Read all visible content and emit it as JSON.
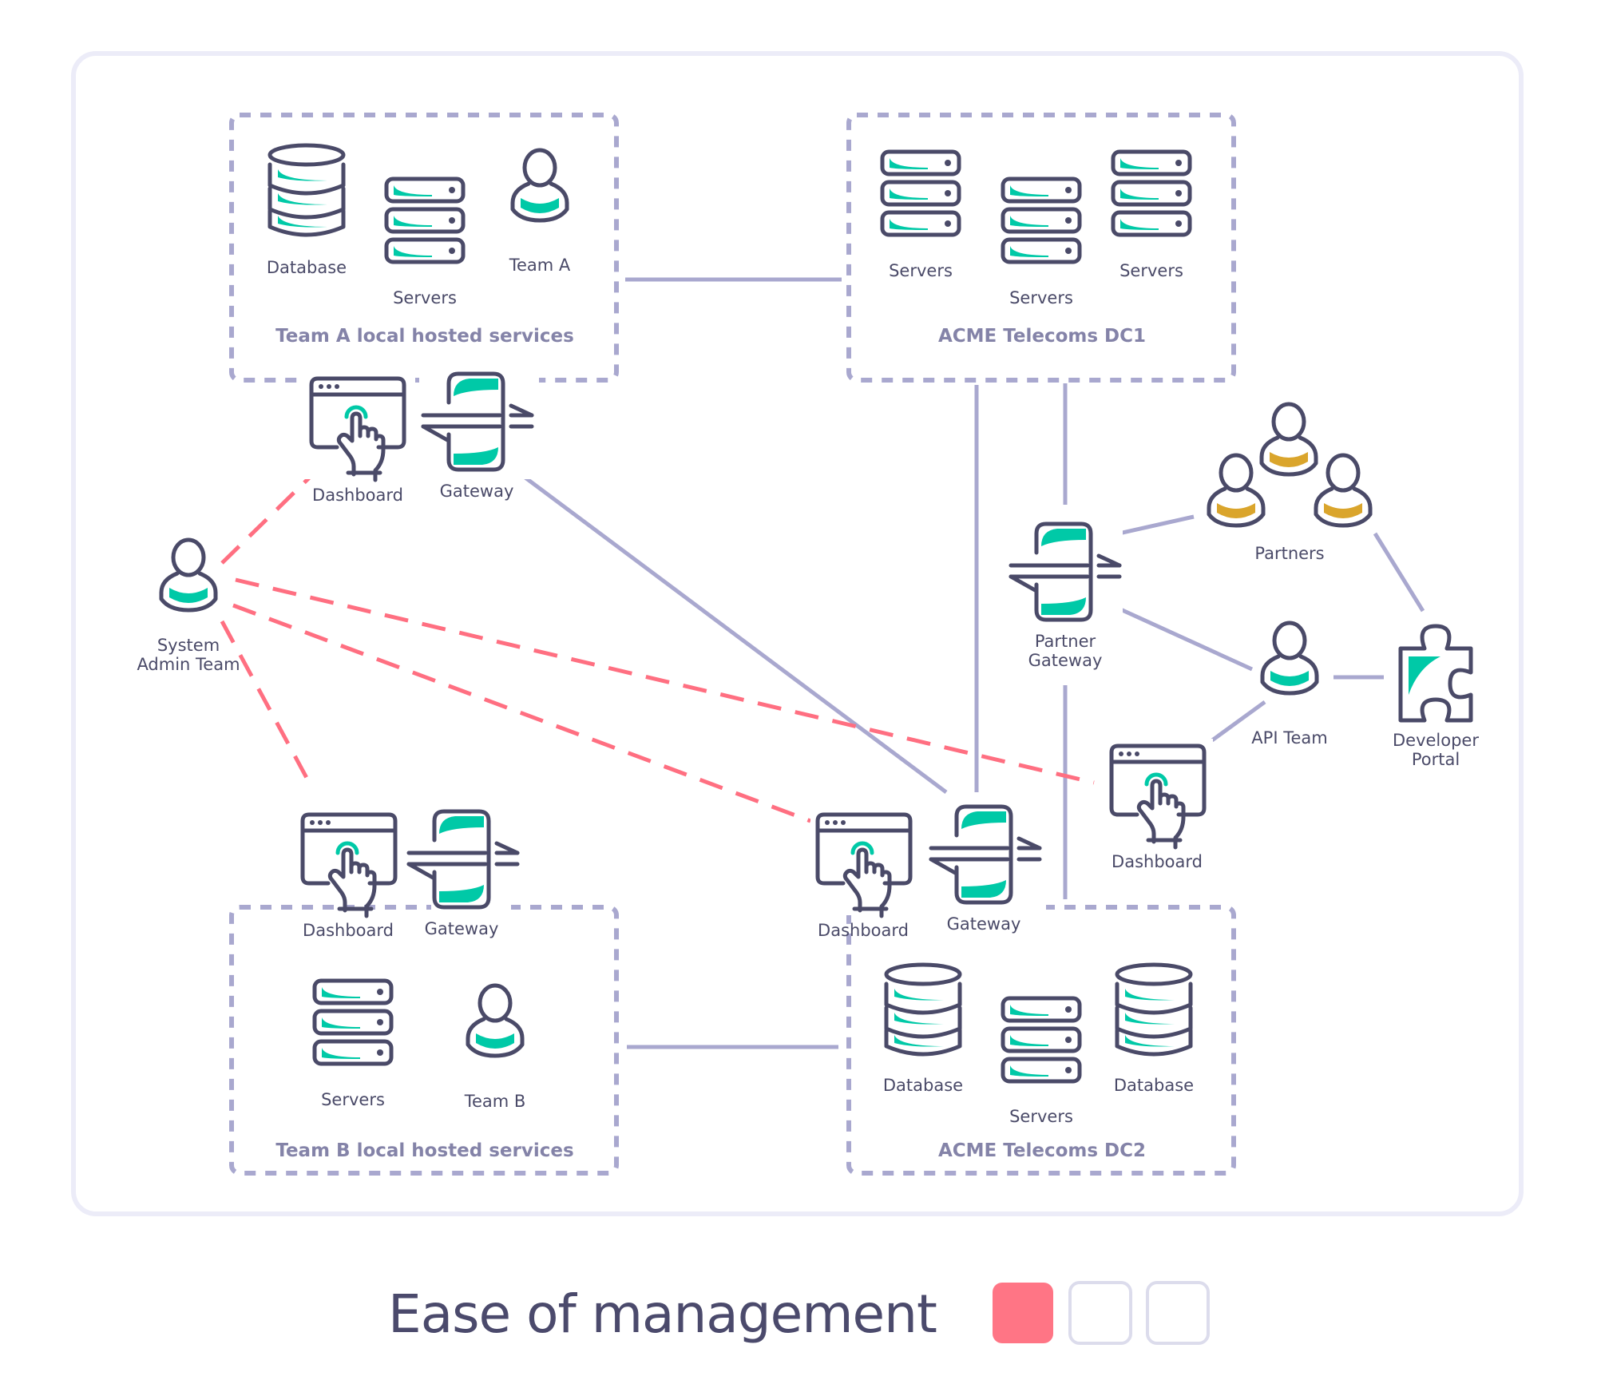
{
  "colors": {
    "icon_stroke": "#4a4a68",
    "accent_teal": "#00c9a7",
    "accent_gold": "#daa52c",
    "connector": "#a9a8cf",
    "admin_link": "#ff6f81",
    "rating_filled": "#ff7585",
    "rating_empty_border": "#dcdcec"
  },
  "groups": {
    "team_a": {
      "title": "Team A local hosted services",
      "items": [
        {
          "icon": "database-icon",
          "label": "Database"
        },
        {
          "icon": "servers-icon",
          "label": "Servers"
        },
        {
          "icon": "user-icon",
          "label": "Team A"
        }
      ]
    },
    "dc1": {
      "title": "ACME Telecoms DC1",
      "items": [
        {
          "icon": "servers-icon",
          "label": "Servers"
        },
        {
          "icon": "servers-icon",
          "label": "Servers"
        },
        {
          "icon": "servers-icon",
          "label": "Servers"
        }
      ]
    },
    "team_b": {
      "title": "Team B local hosted services",
      "items": [
        {
          "icon": "servers-icon",
          "label": "Servers"
        },
        {
          "icon": "user-icon",
          "label": "Team B"
        }
      ]
    },
    "dc2": {
      "title": "ACME Telecoms DC2",
      "items": [
        {
          "icon": "database-icon",
          "label": "Database"
        },
        {
          "icon": "servers-icon",
          "label": "Servers"
        },
        {
          "icon": "database-icon",
          "label": "Database"
        }
      ]
    }
  },
  "nodes": {
    "dashboard_a": "Dashboard",
    "gateway_a": "Gateway",
    "dashboard_b": "Dashboard",
    "gateway_b": "Gateway",
    "dashboard_dc2": "Dashboard",
    "gateway_dc2": "Gateway",
    "dashboard_api": "Dashboard",
    "system_admin_line1": "System",
    "system_admin_line2": "Admin Team",
    "partner_gateway_line1": "Partner",
    "partner_gateway_line2": "Gateway",
    "partners": "Partners",
    "api_team": "API Team",
    "developer_portal_line1": "Developer",
    "developer_portal_line2": "Portal"
  },
  "footer": {
    "title": "Ease of management",
    "rating": {
      "filled": 1,
      "total": 3
    }
  }
}
